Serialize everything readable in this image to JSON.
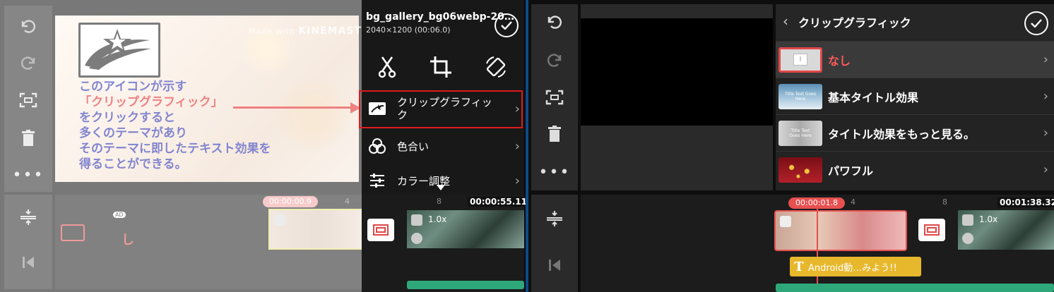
{
  "left": {
    "file_title": "bg_gallery_bg06webp-20…",
    "file_meta": "2040×1200 (00:06.0)",
    "watermark_prefix": "Made with ",
    "watermark_brand": "KINEMASTER",
    "annotation_lines": [
      "このアイコンが示す",
      "「クリップグラフィック」",
      "をクリックすると",
      "多くのテーマがあり",
      "そのテーマに即したテキスト効果を",
      "得ることができる。"
    ],
    "menu": [
      {
        "label": "クリップグラフィッ\nク",
        "icon": "clip-graphics-icon"
      },
      {
        "label": "色合い",
        "icon": "color-tint-icon"
      },
      {
        "label": "カラー調整",
        "icon": "color-adjust-icon"
      }
    ],
    "timeline": {
      "current_time": "00:00:00.9",
      "total_time": "00:00:55.11",
      "ticks": [
        "4",
        "8"
      ],
      "speed": "1.0x",
      "ad_badge": "AD"
    }
  },
  "right": {
    "panel_title": "クリップグラフィック",
    "rows": [
      {
        "label": "なし",
        "thumb_text": "I"
      },
      {
        "label": "基本タイトル効果",
        "thumb_text": "Title Text Goes Here"
      },
      {
        "label": "タイトル効果をもっと見る。",
        "thumb_text": "Title Text Goes Here"
      },
      {
        "label": "パワフル",
        "thumb_text": ""
      }
    ],
    "timeline": {
      "current_time": "00:00:01.8",
      "total_time": "00:01:38.32",
      "ticks": [
        "4",
        "8"
      ],
      "speed": "1.0x",
      "text_clip": "Android動…みよう!!"
    }
  },
  "colors": {
    "accent_red": "#e01b1b",
    "clip_yellow": "#e8b82c",
    "audio_green": "#2ea87a",
    "annotation_blue": "#1a1fa8"
  }
}
